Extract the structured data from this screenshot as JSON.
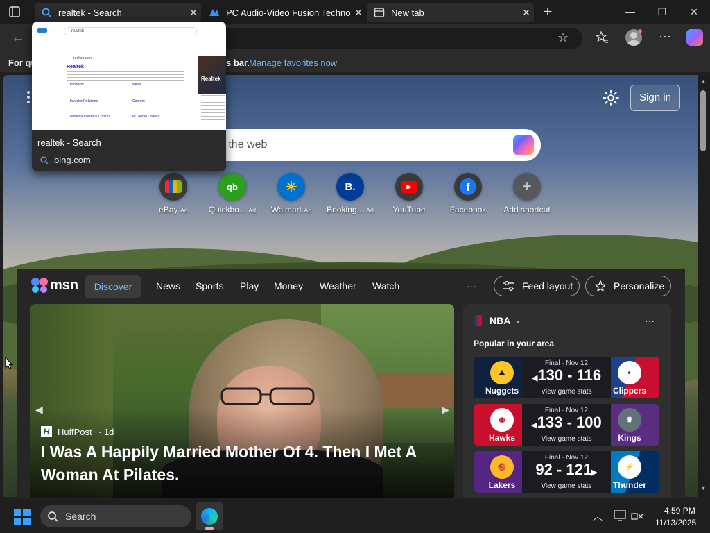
{
  "browser": {
    "tabs": [
      {
        "title": "realtek - Search",
        "icon": "search-icon"
      },
      {
        "title": "PC Audio-Video Fusion Technolo",
        "icon": "realtek-logo-icon"
      },
      {
        "title": "New tab",
        "icon": "new-tab-icon"
      }
    ],
    "favorites_prompt": "For qu",
    "favorites_prompt_tail": "s bar.",
    "manage_favorites": "Manage favorites now"
  },
  "tab_preview": {
    "title": "realtek - Search",
    "domain": "bing.com",
    "thumb": {
      "query": "realtek",
      "site": "realtek.com",
      "heading": "Realtek",
      "links": [
        "Products",
        "News",
        "Investor Relations",
        "Careers",
        "Network Interface Controll...",
        "PC Audio Codecs"
      ],
      "side_title": "Realtek"
    }
  },
  "newtab": {
    "sign_in": "Sign in",
    "search_placeholder": "n the web",
    "quick_links": [
      {
        "label": "eBay",
        "ad": "Ad",
        "color": "#ffffff",
        "glyph": "🛍"
      },
      {
        "label": "Quickbo...",
        "ad": "Ad",
        "color": "#2ca01c",
        "glyph": "qb"
      },
      {
        "label": "Walmart",
        "ad": "Ad",
        "color": "#0071ce",
        "glyph": "✳"
      },
      {
        "label": "Booking...",
        "ad": "Ad",
        "color": "#003b95",
        "glyph": "B."
      },
      {
        "label": "YouTube",
        "ad": "",
        "color": "#ff0000",
        "glyph": "▶"
      },
      {
        "label": "Facebook",
        "ad": "",
        "color": "#1877f2",
        "glyph": "f"
      },
      {
        "label": "Add shortcut",
        "ad": "",
        "color": "#555555",
        "glyph": "+"
      }
    ]
  },
  "msn": {
    "logo": "msn",
    "nav": [
      "Discover",
      "News",
      "Sports",
      "Play",
      "Money",
      "Weather",
      "Watch"
    ],
    "more": "···",
    "feed_layout": "Feed layout",
    "personalize": "Personalize",
    "hero": {
      "source": "HuffPost",
      "age": "· 1d",
      "headline_line1": "I Was A Happily Married Mother Of 4. Then I Met A",
      "headline_line2": "Woman At Pilates."
    },
    "nba": {
      "title": "NBA",
      "subtitle": "Popular in your area",
      "games": [
        {
          "status": "Final · Nov 12",
          "score": "130 - 116",
          "winner": "left",
          "home": "Nuggets",
          "away": "Clippers",
          "home_color": "#0e2240",
          "away_color": "#c8102e",
          "stats": "View game stats"
        },
        {
          "status": "Final · Nov 12",
          "score": "133 - 100",
          "winner": "left",
          "home": "Hawks",
          "away": "Kings",
          "home_color": "#c8102e",
          "away_color": "#5a2d81",
          "stats": "View game stats"
        },
        {
          "status": "Final · Nov 12",
          "score": "92 - 121",
          "winner": "right",
          "home": "Lakers",
          "away": "Thunder",
          "home_color": "#552583",
          "away_color": "#007ac1",
          "stats": "View game stats"
        }
      ]
    }
  },
  "taskbar": {
    "search": "Search",
    "time": "4:59 PM",
    "date": "11/13/2025"
  }
}
